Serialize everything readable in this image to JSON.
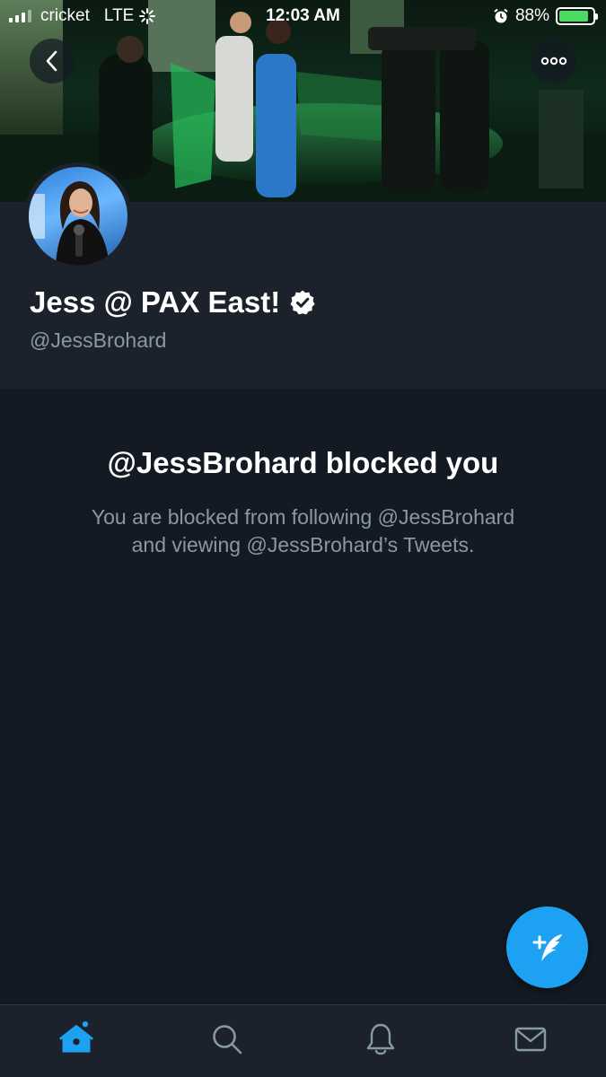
{
  "status_bar": {
    "carrier": "cricket",
    "network": "LTE",
    "time": "12:03 AM",
    "battery_percent": "88%",
    "battery_level": 0.88,
    "icons": [
      "signal-icon",
      "activity-spinner-icon",
      "alarm-icon",
      "battery-charging-icon"
    ]
  },
  "nav": {
    "back_icon": "chevron-left-icon",
    "more_icon": "more-horizontal-icon"
  },
  "profile": {
    "display_name": "Jess @ PAX East!",
    "verified": true,
    "handle": "@JessBrohard",
    "banner_image": "stage-event-photo",
    "avatar_image": "profile-photo"
  },
  "blocked": {
    "title": "@JessBrohard blocked you",
    "line1": "You are blocked from following @JessBrohard",
    "line2": "and viewing @JessBrohard’s Tweets."
  },
  "compose": {
    "icon": "compose-tweet-icon"
  },
  "tab_bar": {
    "items": [
      {
        "name": "home",
        "icon": "home-icon",
        "active": true,
        "has_dot": true
      },
      {
        "name": "search",
        "icon": "search-icon",
        "active": false
      },
      {
        "name": "notifications",
        "icon": "bell-icon",
        "active": false
      },
      {
        "name": "messages",
        "icon": "mail-icon",
        "active": false
      }
    ]
  },
  "colors": {
    "background": "#141a23",
    "header_background": "#1c222c",
    "accent": "#1da1f2",
    "secondary_text": "#8899a6",
    "battery_green": "#4cd964"
  }
}
